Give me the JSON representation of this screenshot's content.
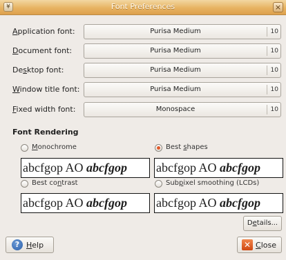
{
  "window": {
    "title": "Font Preferences",
    "close_glyph": "×",
    "app_icon_glyph": "¥"
  },
  "fonts": [
    {
      "pre": "",
      "key": "A",
      "post": "pplication font:",
      "font": "Purisa Medium",
      "size": "10"
    },
    {
      "pre": "",
      "key": "D",
      "post": "ocument font:",
      "font": "Purisa Medium",
      "size": "10"
    },
    {
      "pre": "De",
      "key": "s",
      "post": "ktop font:",
      "font": "Purisa Medium",
      "size": "10"
    },
    {
      "pre": "",
      "key": "W",
      "post": "indow title font:",
      "font": "Purisa Medium",
      "size": "10"
    },
    {
      "pre": "",
      "key": "F",
      "post": "ixed width font:",
      "font": "Monospace",
      "size": "10"
    }
  ],
  "rendering": {
    "title": "Font Rendering",
    "options": [
      {
        "pre": "",
        "key": "M",
        "post": "onochrome",
        "selected": false
      },
      {
        "pre": "Best ",
        "key": "s",
        "post": "hapes",
        "selected": true
      },
      {
        "pre": "Best co",
        "key": "n",
        "post": "trast",
        "selected": false
      },
      {
        "pre": "Sub",
        "key": "p",
        "post": "ixel smoothing (LCDs)",
        "selected": false
      }
    ],
    "sample_plain": "abcfgop AO ",
    "sample_styled": "abcfgop"
  },
  "buttons": {
    "details": {
      "pre": "D",
      "key": "e",
      "post": "tails..."
    },
    "help": {
      "pre": "",
      "key": "H",
      "post": "elp",
      "icon": "help-icon",
      "glyph": "?"
    },
    "close": {
      "pre": "",
      "key": "C",
      "post": "lose",
      "icon": "close-icon",
      "glyph": "✕"
    }
  },
  "colors": {
    "titlebar": "#e7b362",
    "radio_selected": "#e0592a",
    "background": "#efebe7"
  }
}
